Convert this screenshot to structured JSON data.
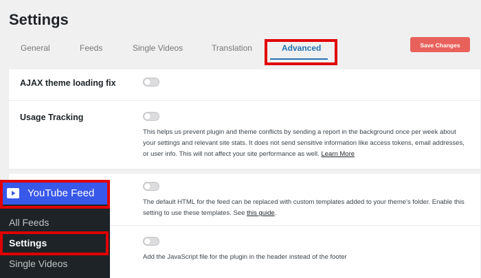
{
  "page": {
    "title": "Settings"
  },
  "tabs": [
    {
      "label": "General"
    },
    {
      "label": "Feeds"
    },
    {
      "label": "Single Videos"
    },
    {
      "label": "Translation"
    },
    {
      "label": "Advanced"
    }
  ],
  "active_tab": "Advanced",
  "save_button": {
    "label": "Save Changes"
  },
  "settings": {
    "ajax": {
      "label": "AJAX theme loading fix",
      "enabled": false
    },
    "usage": {
      "label": "Usage Tracking",
      "enabled": false,
      "description": "This helps us prevent plugin and theme conflicts by sending a report in the background once per week about your settings and relevant site stats. It does not send sensitive information like access tokens, email addresses, or user info. This will not affect your site performance as well.",
      "link": "Learn More"
    },
    "templates": {
      "enabled": false,
      "description": "The default HTML for the feed can be replaced with custom templates added to your theme's folder. Enable this setting to use these templates. See",
      "link": "this guide",
      "after_link": "."
    },
    "js_header": {
      "enabled": false,
      "description": "Add the JavaScript file for the plugin in the header instead of the footer"
    }
  },
  "sidebar": {
    "header": "YouTube Feed",
    "items": [
      {
        "label": "All Feeds"
      },
      {
        "label": "Settings"
      },
      {
        "label": "Single Videos"
      }
    ],
    "current": "Settings"
  },
  "colors": {
    "accent": "#2271b1",
    "save_button": "#e8615a",
    "highlight": "#e00000",
    "sidebar_bg": "#1d2327",
    "sidebar_header": "#3858e9"
  }
}
